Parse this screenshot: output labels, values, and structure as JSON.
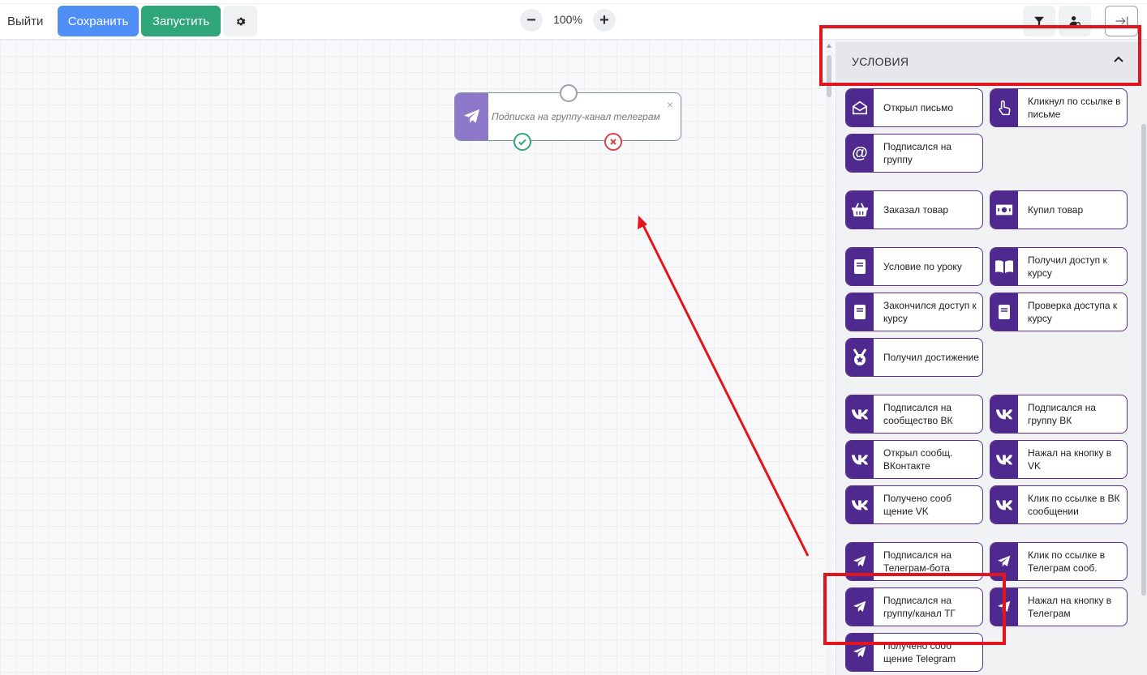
{
  "toolbar": {
    "exit_label": "Выйти",
    "save_label": "Сохранить",
    "run_label": "Запустить",
    "zoom_level": "100%",
    "zoom_minus": "−",
    "zoom_plus": "+"
  },
  "canvas": {
    "node": {
      "title": "Подписка на группу-канал телеграм",
      "close": "×",
      "icon": "telegram-icon"
    }
  },
  "sidebar": {
    "section_title": "УСЛОВИЯ",
    "cards": [
      {
        "label": "Открыл письмо",
        "icon": "envelope-open-icon"
      },
      {
        "label": "Кликнул по ссылке в письме",
        "icon": "hand-pointer-icon"
      },
      {
        "label": "Подписался на группу",
        "icon": "at-icon"
      },
      {
        "label": "Заказал товар",
        "icon": "basket-icon"
      },
      {
        "label": "Купил товар",
        "icon": "money-icon"
      },
      {
        "label": "Условие по уроку",
        "icon": "book-icon"
      },
      {
        "label": "Получил доступ к курсу",
        "icon": "book-open-icon"
      },
      {
        "label": "Закончился доступ к курсу",
        "icon": "book-icon"
      },
      {
        "label": "Проверка доступа к курсу",
        "icon": "book-icon"
      },
      {
        "label": "Получил достижение",
        "icon": "medal-icon"
      },
      {
        "label": "Подписался на сообщество ВК",
        "icon": "vk-icon"
      },
      {
        "label": "Подписался на группу ВК",
        "icon": "vk-icon"
      },
      {
        "label": "Открыл сообщ. ВКонтакте",
        "icon": "vk-icon"
      },
      {
        "label": "Нажал на кнопку в VK",
        "icon": "vk-icon"
      },
      {
        "label": "Получено сооб щение VK",
        "icon": "vk-icon"
      },
      {
        "label": "Клик по ссылке в ВК сообщении",
        "icon": "vk-icon"
      },
      {
        "label": "Подписался на Телеграм-бота",
        "icon": "telegram-icon"
      },
      {
        "label": "Клик по ссылке в Телеграм сооб.",
        "icon": "telegram-icon"
      },
      {
        "label": "Подписался на группу/канал ТГ",
        "icon": "telegram-icon"
      },
      {
        "label": "Нажал на кнопку в Телеграм",
        "icon": "telegram-icon"
      },
      {
        "label": "Получено сооб щение Telegram",
        "icon": "telegram-icon"
      }
    ]
  },
  "colors": {
    "save": "#4f8ff7",
    "run": "#2fa57a",
    "card_icon_bg": "#4e2a8e",
    "annotation": "#e3141c",
    "success": "#2fa57a",
    "error": "#d9434e"
  }
}
